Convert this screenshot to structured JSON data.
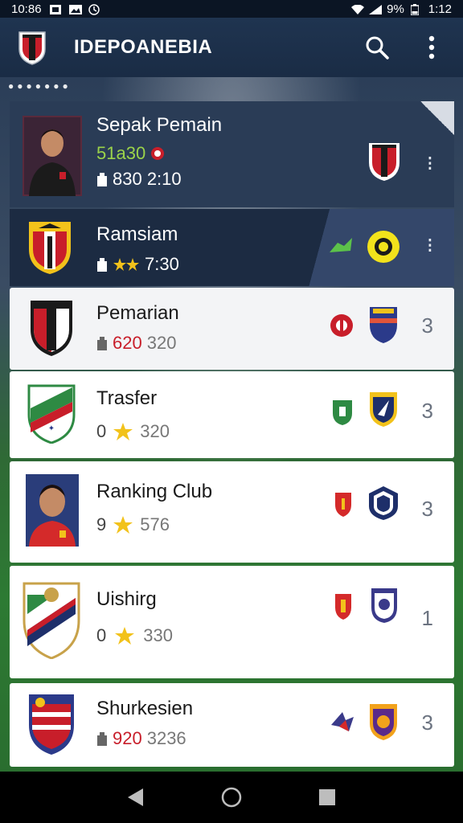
{
  "status_bar": {
    "time": "10:86",
    "battery": "9%",
    "clock": "1:12"
  },
  "app_bar": {
    "title": "IDEPOANEBIA",
    "search_icon": "search-icon",
    "menu_icon": "more-vert-icon"
  },
  "list": [
    {
      "name": "Sepak Pemain",
      "sub1": "51a30",
      "stats": "830 2:10",
      "rank": "⁝"
    },
    {
      "name": "Ramsiam",
      "stats": "7:30",
      "rank": "⁝"
    },
    {
      "name": "Pemarian",
      "stat_red": "620",
      "stats": "320",
      "rank": "3"
    },
    {
      "name": "Trasfer",
      "stat_prefix": "0",
      "stats": "320",
      "rank": "3"
    },
    {
      "name": "Ranking Club",
      "stat_prefix": "9",
      "stats": "576",
      "rank": "3"
    },
    {
      "name": "Uishirg",
      "stat_prefix": "0",
      "stats": "330",
      "rank": "1"
    },
    {
      "name": "Shurkesien",
      "stat_red": "920",
      "stats": "3236",
      "rank": "3"
    }
  ],
  "colors": {
    "accent": "#1f3450",
    "brand_red": "#c81e2a",
    "star": "#f2c21b"
  }
}
